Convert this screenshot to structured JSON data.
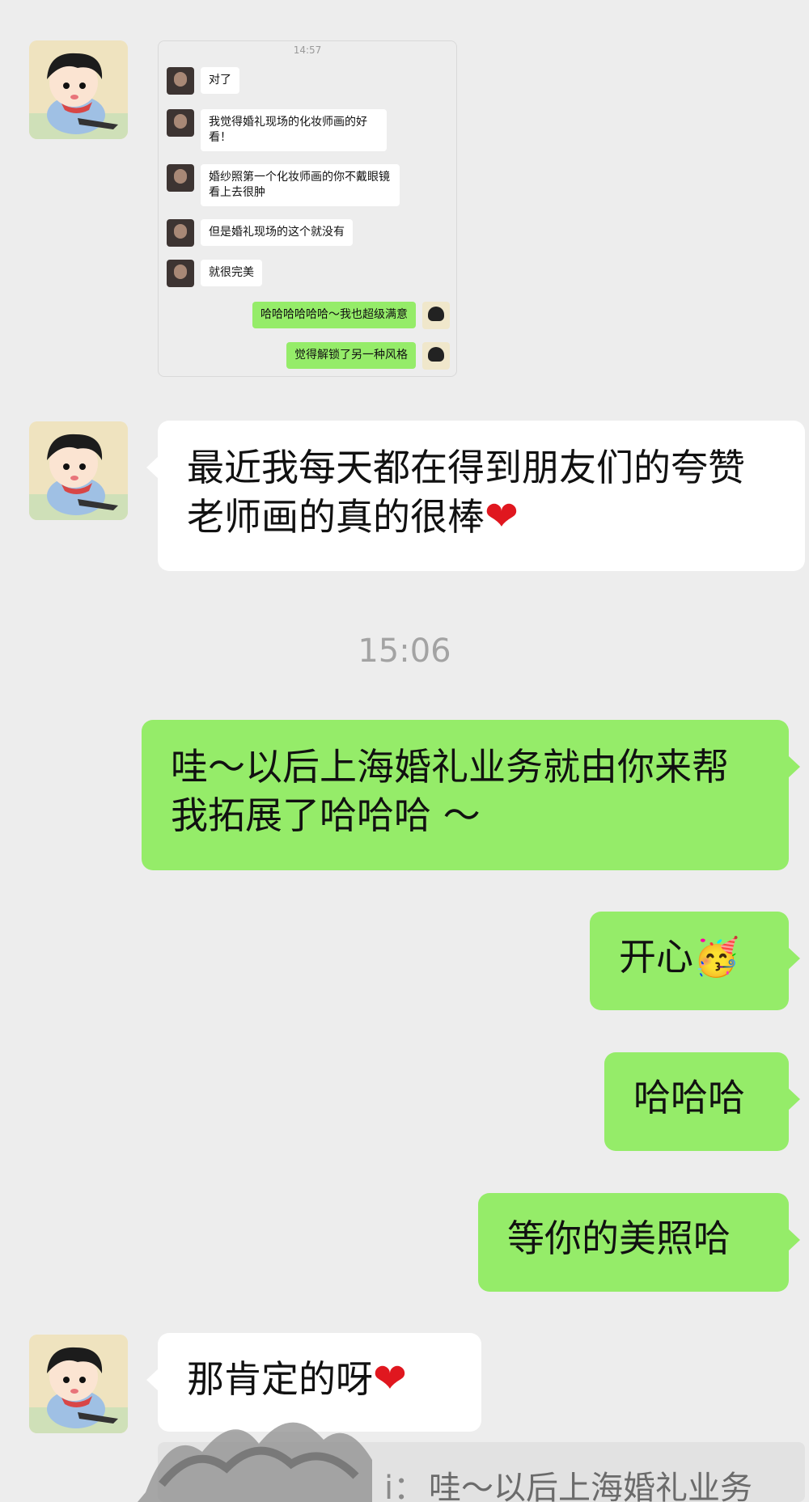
{
  "embedded_screenshot": {
    "time": "14:57",
    "messages": [
      {
        "side": "left",
        "text": "对了"
      },
      {
        "side": "left",
        "text": "我觉得婚礼现场的化妆师画的好看！"
      },
      {
        "side": "left",
        "text": "婚纱照第一个化妆师画的你不戴眼镜 看上去很肿"
      },
      {
        "side": "left",
        "text": "但是婚礼现场的这个就没有"
      },
      {
        "side": "left",
        "text": "就很完美"
      },
      {
        "side": "right",
        "text": "哈哈哈哈哈哈～我也超级满意"
      },
      {
        "side": "right",
        "text": "觉得解锁了另一种风格"
      }
    ]
  },
  "messages": [
    {
      "side": "left",
      "text": "最近我每天都在得到朋友们的夸赞 老师画的真的很棒",
      "emoji": "❤"
    },
    {
      "side": "right",
      "text": "哇～以后上海婚礼业务就由你来帮我拓展了哈哈哈 ～"
    },
    {
      "side": "right",
      "text": "开心",
      "emoji": "🥳"
    },
    {
      "side": "right",
      "text": "哈哈哈"
    },
    {
      "side": "right",
      "text": "等你的美照哈"
    },
    {
      "side": "left",
      "text": "那肯定的呀",
      "emoji": "❤"
    }
  ],
  "timestamp": "15:06",
  "quote": {
    "sender": "i：",
    "text": "哇～以后上海婚礼业务"
  },
  "colors": {
    "background": "#ededed",
    "bubble_me": "#95ec69",
    "bubble_other": "#ffffff",
    "timestamp": "#a3a3a3"
  }
}
